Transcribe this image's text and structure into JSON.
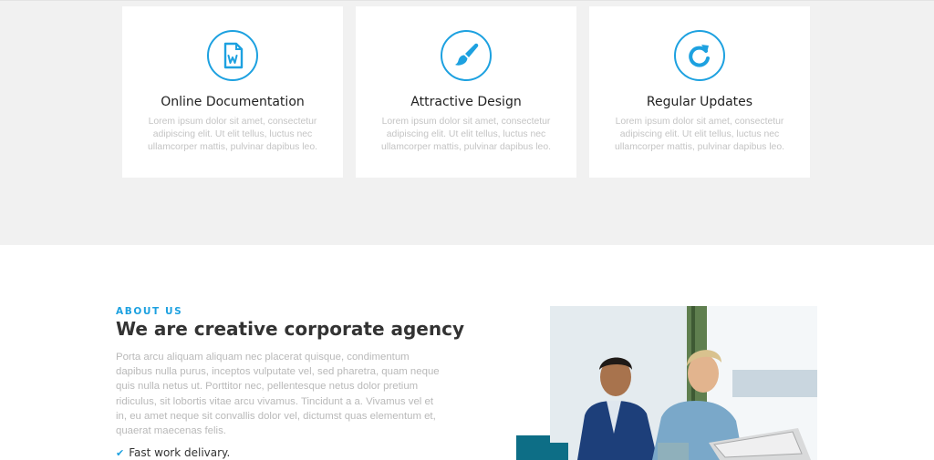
{
  "features": [
    {
      "icon": "document-word-icon",
      "title": "Online Documentation",
      "text": "Lorem ipsum dolor sit amet, consectetur adipiscing elit. Ut elit tellus, luctus nec ullamcorper mattis, pulvinar dapibus leo."
    },
    {
      "icon": "paint-brush-icon",
      "title": "Attractive Design",
      "text": "Lorem ipsum dolor sit amet, consectetur adipiscing elit. Ut elit tellus, luctus nec ullamcorper mattis, pulvinar dapibus leo."
    },
    {
      "icon": "refresh-icon",
      "title": "Regular Updates",
      "text": "Lorem ipsum dolor sit amet, consectetur adipiscing elit. Ut elit tellus, luctus nec ullamcorper mattis, pulvinar dapibus leo."
    }
  ],
  "about": {
    "eyebrow": "ABOUT US",
    "heading": "We are creative corporate agency",
    "paragraph": "Porta arcu aliquam aliquam nec placerat quisque, condimentum dapibus nulla purus, inceptos vulputate vel, sed pharetra, quam neque quis nulla netus ut. Porttitor nec, pellentesque netus dolor pretium ridiculus, sit lobortis vitae arcu vivamus. Tincidunt a a. Vivamus vel et in, eu amet neque sit convallis dolor vel, dictumst quas elementum et, quaerat maecenas felis.",
    "checklist": [
      {
        "icon": "check-icon",
        "label": "Fast work delivary."
      }
    ],
    "photo_alt_icon": "business-meeting-photo"
  },
  "colors": {
    "accent": "#1da1e0",
    "section_bg": "#f1f1f1",
    "heading": "#333333",
    "muted_text": "#b9b9b9"
  }
}
